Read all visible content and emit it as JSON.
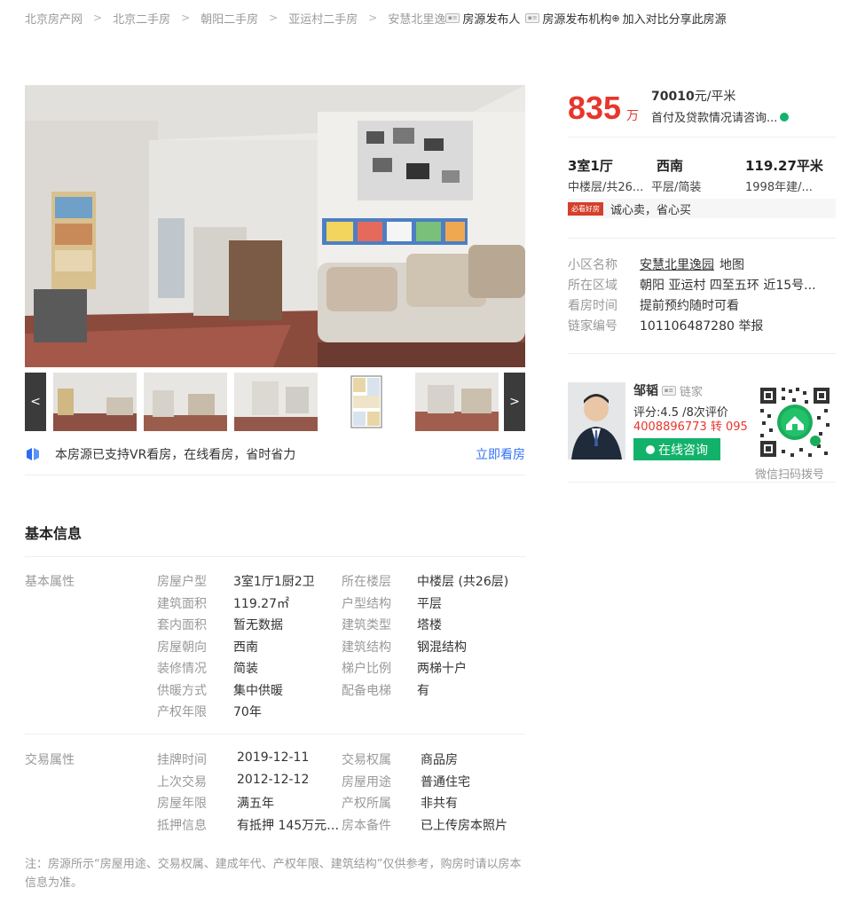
{
  "breadcrumb": {
    "items": [
      "北京房产网",
      "北京二手房",
      "朝阳二手房",
      "亚运村二手房",
      "安慧北里逸"
    ],
    "separator": ">",
    "actions": {
      "publisher": "房源发布人",
      "agency": "房源发布机构",
      "compare": "加入对比",
      "share": "分享此房源"
    }
  },
  "gallery": {
    "prev_label": "<",
    "next_label": ">",
    "vr_text": "本房源已支持VR看房，在线看房，省时省力",
    "vr_link": "立即看房"
  },
  "price": {
    "total": "835",
    "total_unit": "万",
    "unit_price": "70010",
    "unit_price_suffix": "元/平米",
    "loan_text": "首付及贷款情况请咨询..."
  },
  "rooms": {
    "layout": "3室1厅",
    "floor": "中楼层/共26...",
    "orientation": "西南",
    "structure": "平层/简装",
    "area": "119.27平米",
    "year": "1998年建/..."
  },
  "tag": {
    "badge": "必看好房",
    "text": "诚心卖，省心买"
  },
  "overview": {
    "rows": [
      {
        "key": "小区名称",
        "value": "安慧北里逸园",
        "extra": "地图"
      },
      {
        "key": "所在区域",
        "value": "朝阳 亚运村 四至五环  近15号..."
      },
      {
        "key": "看房时间",
        "value": "提前预约随时可看"
      },
      {
        "key": "链家编号",
        "value": "101106487280 举报"
      }
    ]
  },
  "agent": {
    "name": "邹韬",
    "company": "链家",
    "score": "评分:4.5 /8次评价",
    "phone": "4008896773 转 095",
    "consult": "在线咨询",
    "qr_label": "微信扫码拨号"
  },
  "basic_info": {
    "title": "基本信息",
    "basic": {
      "label": "基本属性",
      "rows": [
        {
          "k1": "房屋户型",
          "v1": "3室1厅1厨2卫",
          "k2": "所在楼层",
          "v2": "中楼层 (共26层)"
        },
        {
          "k1": "建筑面积",
          "v1": "119.27㎡",
          "k2": "户型结构",
          "v2": "平层"
        },
        {
          "k1": "套内面积",
          "v1": "暂无数据",
          "k2": "建筑类型",
          "v2": "塔楼"
        },
        {
          "k1": "房屋朝向",
          "v1": "西南",
          "k2": "建筑结构",
          "v2": "钢混结构"
        },
        {
          "k1": "装修情况",
          "v1": "简装",
          "k2": "梯户比例",
          "v2": "两梯十户"
        },
        {
          "k1": "供暖方式",
          "v1": "集中供暖",
          "k2": "配备电梯",
          "v2": "有"
        },
        {
          "k1": "产权年限",
          "v1": "70年",
          "k2": "",
          "v2": ""
        }
      ]
    },
    "transaction": {
      "label": "交易属性",
      "rows": [
        {
          "k1": "挂牌时间",
          "v1": "2019-12-11",
          "k2": "交易权属",
          "v2": "商品房"
        },
        {
          "k1": "上次交易",
          "v1": "2012-12-12",
          "k2": "房屋用途",
          "v2": "普通住宅"
        },
        {
          "k1": "房屋年限",
          "v1": "满五年",
          "k2": "产权所属",
          "v2": "非共有"
        },
        {
          "k1": "抵押信息",
          "v1": "有抵押 145万元 ...",
          "k2": "房本备件",
          "v2": "已上传房本照片"
        }
      ]
    },
    "note": "注：房源所示“房屋用途、交易权属、建成年代、产权年限、建筑结构”仅供参考，购房时请以房本信息为准。"
  },
  "colors": {
    "price_red": "#e7362c",
    "link_blue": "#3072f6",
    "consult_green": "#13b26b"
  }
}
